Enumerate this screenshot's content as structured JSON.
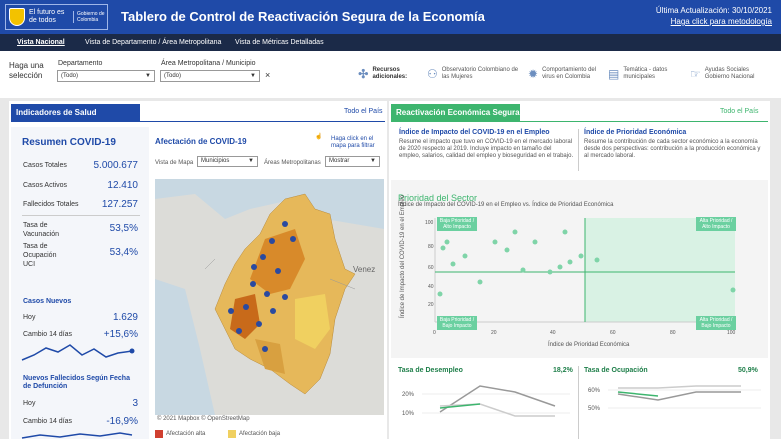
{
  "header": {
    "logo_line1": "El futuro es de todos",
    "logo_line2": "Gobierno de Colombia",
    "title": "Tablero de Control de Reactivación Segura de la Economía",
    "update": "Última Actualización: 30/10/2021",
    "method_link": "Haga click para metodología"
  },
  "nav": {
    "tab1": "Vista Nacional",
    "tab2": "Vista de Departamento / Área Metropolitana",
    "tab3": "Vista de Métricas Detalladas"
  },
  "filters": {
    "prompt": "Haga una selección",
    "dept_label": "Departamento",
    "dept_value": "(Todo)",
    "area_label": "Área Metropolitana / Municipio",
    "area_value": "(Todo)",
    "clear": "×"
  },
  "resources": {
    "label": "Recursos adicionales:",
    "items": [
      "Observatorio Colombiano de las Mujeres",
      "Comportamiento del virus en Colombia",
      "Temática - datos municipales",
      "Ayudas Sociales Gobierno Nacional"
    ]
  },
  "health": {
    "tab": "Indicadores de Salud",
    "all": "Todo el País",
    "summary_title": "Resumen COVID-19",
    "rows": [
      {
        "label": "Casos Totales",
        "value": "5.000.677"
      },
      {
        "label": "Casos Activos",
        "value": "12.410"
      },
      {
        "label": "Fallecidos Totales",
        "value": "127.257"
      },
      {
        "label": "Tasa de Vacunación",
        "value": "53,5%"
      },
      {
        "label": "Tasa de Ocupación UCI",
        "value": "53,4%"
      }
    ],
    "new_cases": {
      "title": "Casos Nuevos",
      "hoy_label": "Hoy",
      "hoy_value": "1.629",
      "change_label": "Cambio 14 días",
      "change_value": "+15,6%"
    },
    "new_deaths": {
      "title": "Nuevos Fallecidos Según Fecha de Defunción",
      "hoy_label": "Hoy",
      "hoy_value": "3",
      "change_label": "Cambio 14 días",
      "change_value": "-16,9%"
    }
  },
  "map": {
    "title": "Afectación de COVID-19",
    "hint": "Haga click en el mapa para filtrar",
    "vista_label": "Vista de Mapa",
    "vista_value": "Municipios",
    "areas_label": "Áreas Metropolitanas",
    "areas_value": "Mostrar",
    "credit": "© 2021 Mapbox  © OpenStreetMap",
    "legend_high": "Afectación alta",
    "legend_low": "Afectación baja",
    "country_label": "Venez"
  },
  "econ": {
    "tab": "Reactivación Económica Segura",
    "all": "Todo el País",
    "imp_title": "Índice de Impacto del COVID-19 en el Empleo",
    "imp_desc": "Resume el impacto que tuvo en COVID-19 en el mercado laboral de 2020 respecto al 2019. Incluye impacto en tamaño del empleo, salarios, calidad del empleo y bioseguridad en el trabajo.",
    "pri_title": "Índice de Prioridad Económica",
    "pri_desc": "Resume la contribución de cada sector económico a la economía desde dos perspectivas: contribución a la producción económica y al mercado laboral.",
    "chart_title": "Prioridad del Sector",
    "chart_sub": "Índice de Impacto del COVID-19 en el Empleo vs. Índice de Prioridad Económica",
    "q_tl": "Baja Prioridad / Alto Impacto",
    "q_tr": "Alta Prioridad / Alto Impacto",
    "q_bl": "Baja Prioridad / Bajo Impacto",
    "q_br": "Alta Prioridad / Bajo Impacto",
    "desempleo_title": "Tasa de Desempleo",
    "desempleo_value": "18,2%",
    "ocupacion_title": "Tasa de Ocupación",
    "ocupacion_value": "50,9%"
  },
  "colors": {
    "header": "#1f4aa8",
    "green": "#3db56e",
    "nav": "#1b2a48"
  }
}
